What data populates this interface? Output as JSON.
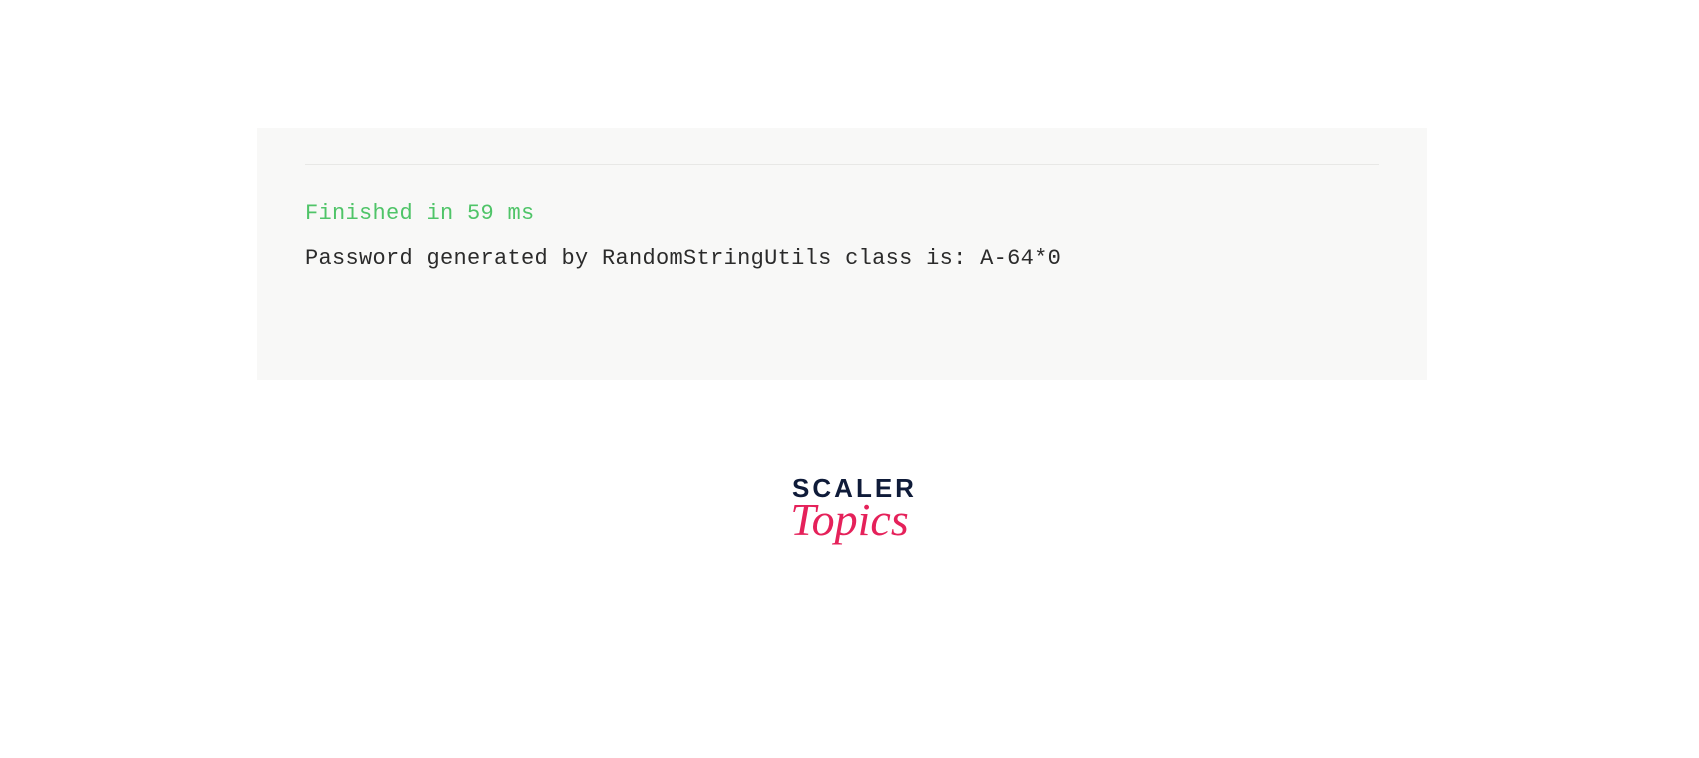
{
  "console": {
    "status_line": "Finished in 59 ms",
    "output_line": "Password generated by RandomStringUtils class is: A-64*0"
  },
  "logo": {
    "line1": "SCALER",
    "line2": "Topics"
  }
}
